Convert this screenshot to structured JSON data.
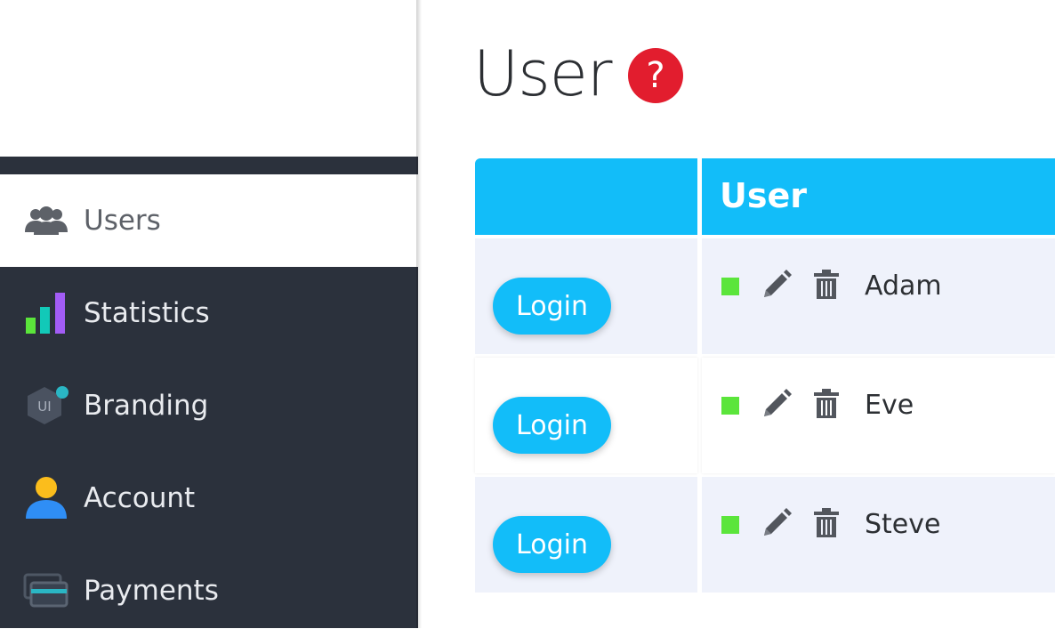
{
  "sidebar": {
    "items": [
      {
        "label": "Users",
        "icon": "users-icon",
        "active": true
      },
      {
        "label": "Statistics",
        "icon": "bar-chart-icon",
        "active": false
      },
      {
        "label": "Branding",
        "icon": "ui-hexagon-icon",
        "active": false
      },
      {
        "label": "Account",
        "icon": "person-icon",
        "active": false
      },
      {
        "label": "Payments",
        "icon": "credit-card-icon",
        "active": false
      }
    ]
  },
  "main": {
    "title": "User",
    "help_icon": "question-mark-icon",
    "table": {
      "columns": [
        "",
        "User"
      ],
      "rows": [
        {
          "action_label": "Login",
          "status": "active",
          "name": "Adam"
        },
        {
          "action_label": "Login",
          "status": "active",
          "name": "Eve"
        },
        {
          "action_label": "Login",
          "status": "active",
          "name": "Steve"
        }
      ]
    }
  },
  "colors": {
    "sidebar_bg": "#2b313c",
    "accent": "#12bdf9",
    "help_red": "#e21d2e",
    "status_green": "#5be53b",
    "row_alt": "#eff2fb"
  }
}
